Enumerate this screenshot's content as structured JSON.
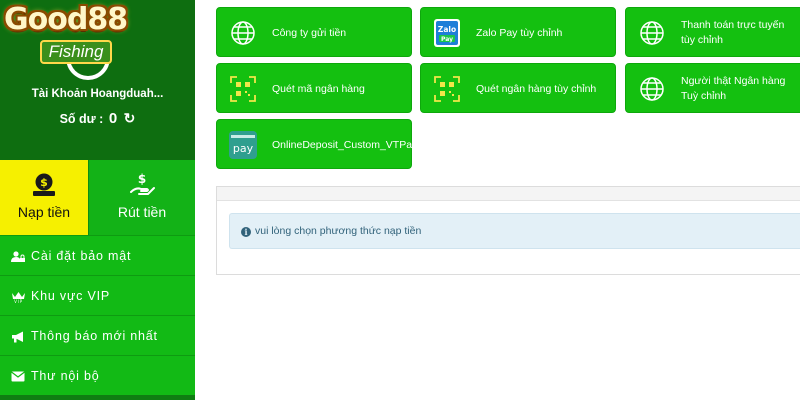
{
  "brand": {
    "logo_main": "Good88",
    "logo_sub": "Fishing"
  },
  "account": {
    "username": "Tài Khoản Hoangduah...",
    "balance_label": "Số dư :",
    "balance_value": "0"
  },
  "actions": {
    "deposit_label": "Nạp tiền",
    "withdraw_label": "Rút tiền"
  },
  "menu": [
    {
      "label": "Cài đặt bảo mật",
      "icon": "user-lock-icon"
    },
    {
      "label": "Khu vực VIP",
      "icon": "vip-crown-icon"
    },
    {
      "label": "Thông báo mới nhất",
      "icon": "megaphone-icon"
    },
    {
      "label": "Thư nội bộ",
      "icon": "envelope-icon"
    }
  ],
  "methods": [
    {
      "label": "Công ty gửi tiền",
      "icon": "globe-icon"
    },
    {
      "label": "Zalo Pay tùy chỉnh",
      "icon": "zalopay-icon",
      "icon_text": "Zalo",
      "icon_subtext": "Pay"
    },
    {
      "label": "Thanh toán trực tuyến tùy chỉnh",
      "icon": "globe-icon"
    },
    {
      "label": "Quét mã ngân hàng",
      "icon": "qr-scan-icon"
    },
    {
      "label": "Quét ngân hàng tùy chỉnh",
      "icon": "qr-scan-icon"
    },
    {
      "label": "Người thật Ngân hàng Tuỳ chỉnh",
      "icon": "globe-icon"
    },
    {
      "label": "OnlineDeposit_Custom_VTPay",
      "icon": "vtpay-icon",
      "icon_text": "pay"
    }
  ],
  "notice": {
    "text": "vui lòng chọn phương thức nạp tiền",
    "icon": "info-icon"
  },
  "colors": {
    "sidebar_dark": "#0e6e10",
    "menu_green": "#12ba15",
    "method_green": "#14c010",
    "deposit_yellow": "#f6f000",
    "alert_bg": "#e3f0f7"
  }
}
